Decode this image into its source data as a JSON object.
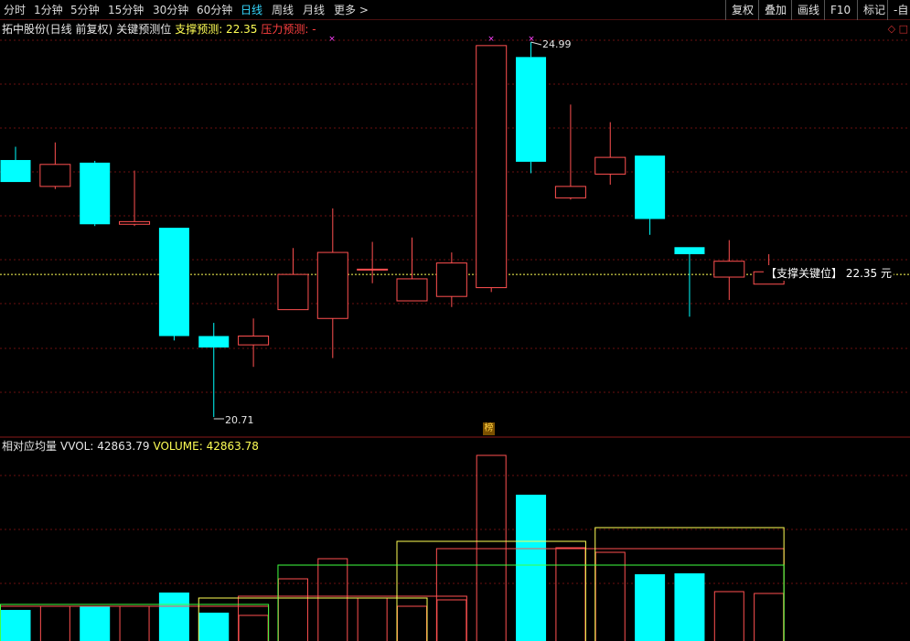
{
  "toolbar": {
    "periods": [
      {
        "label": "分时",
        "active": false
      },
      {
        "label": "1分钟",
        "active": false
      },
      {
        "label": "5分钟",
        "active": false
      },
      {
        "label": "15分钟",
        "active": false
      },
      {
        "label": "30分钟",
        "active": false
      },
      {
        "label": "60分钟",
        "active": false
      },
      {
        "label": "日线",
        "active": true
      },
      {
        "label": "周线",
        "active": false
      },
      {
        "label": "月线",
        "active": false
      },
      {
        "label": "更多 >",
        "active": false
      }
    ],
    "right_buttons": [
      "复权",
      "叠加",
      "画线",
      "F10",
      "标记",
      "-自"
    ]
  },
  "price_panel": {
    "stock_name": "拓中股份(日线 前复权)",
    "indicator_name": "关键预测位",
    "support_label": "支撑预测: 22.35",
    "pressure_label": "压力预测: -",
    "support_line_label": "【支撑关键位】 22.35 元",
    "high_annotation": "24.99",
    "low_annotation": "20.71",
    "corner_icons": "◇ □",
    "badge": "榜"
  },
  "volume_panel": {
    "title": "相对应均量",
    "vvol_label": "VVOL: 42863.79",
    "volume_label": "VOLUME: 42863.78"
  },
  "colors": {
    "up": "#ff5050",
    "down": "#00ffff",
    "grid": "#6a1010",
    "support": "#ffff55"
  },
  "chart_data": {
    "type": "candlestick",
    "support_price": 22.35,
    "price_high": 24.99,
    "price_low": 20.71,
    "candles": [
      {
        "o": 23.65,
        "h": 23.8,
        "l": 23.45,
        "c": 23.4
      },
      {
        "o": 23.35,
        "h": 23.85,
        "l": 23.32,
        "c": 23.6
      },
      {
        "o": 23.62,
        "h": 23.64,
        "l": 22.9,
        "c": 22.92
      },
      {
        "o": 22.92,
        "h": 23.53,
        "l": 22.9,
        "c": 22.95
      },
      {
        "o": 22.88,
        "h": 22.88,
        "l": 21.6,
        "c": 21.65
      },
      {
        "o": 21.65,
        "h": 21.8,
        "l": 20.73,
        "c": 21.52
      },
      {
        "o": 21.55,
        "h": 21.85,
        "l": 21.3,
        "c": 21.65
      },
      {
        "o": 21.95,
        "h": 22.65,
        "l": 21.95,
        "c": 22.35
      },
      {
        "o": 21.85,
        "h": 23.1,
        "l": 21.4,
        "c": 22.6
      },
      {
        "o": 22.4,
        "h": 22.72,
        "l": 22.25,
        "c": 22.41
      },
      {
        "o": 22.05,
        "h": 22.77,
        "l": 22.05,
        "c": 22.3
      },
      {
        "o": 22.1,
        "h": 22.6,
        "l": 21.98,
        "c": 22.48
      },
      {
        "o": 22.2,
        "h": 24.95,
        "l": 22.15,
        "c": 24.95
      },
      {
        "o": 24.82,
        "h": 24.99,
        "l": 23.5,
        "c": 23.63
      },
      {
        "o": 23.22,
        "h": 24.28,
        "l": 23.2,
        "c": 23.35
      },
      {
        "o": 23.49,
        "h": 24.08,
        "l": 23.37,
        "c": 23.68
      },
      {
        "o": 23.7,
        "h": 23.7,
        "l": 22.8,
        "c": 22.98
      },
      {
        "o": 22.66,
        "h": 22.66,
        "l": 21.87,
        "c": 22.58
      },
      {
        "o": 22.32,
        "h": 22.74,
        "l": 22.06,
        "c": 22.5
      },
      {
        "o": 22.24,
        "h": 22.58,
        "l": 22.24,
        "c": 22.38
      }
    ],
    "volumes": [
      {
        "v": 34000,
        "dir": "down"
      },
      {
        "v": 38000,
        "dir": "up"
      },
      {
        "v": 38000,
        "dir": "down"
      },
      {
        "v": 38000,
        "dir": "up"
      },
      {
        "v": 53000,
        "dir": "down"
      },
      {
        "v": 31000,
        "dir": "down"
      },
      {
        "v": 28000,
        "dir": "up"
      },
      {
        "v": 68000,
        "dir": "up"
      },
      {
        "v": 90000,
        "dir": "up"
      },
      {
        "v": 47000,
        "dir": "up"
      },
      {
        "v": 38000,
        "dir": "up"
      },
      {
        "v": 45000,
        "dir": "up"
      },
      {
        "v": 203000,
        "dir": "up"
      },
      {
        "v": 160000,
        "dir": "down"
      },
      {
        "v": 102000,
        "dir": "up"
      },
      {
        "v": 97000,
        "dir": "up"
      },
      {
        "v": 73000,
        "dir": "down"
      },
      {
        "v": 74000,
        "dir": "down"
      },
      {
        "v": 54000,
        "dir": "up"
      },
      {
        "v": 52000,
        "dir": "up"
      }
    ],
    "volume_avg_lines": [
      {
        "color": "#ff5050",
        "segments": [
          {
            "from": 0,
            "to": 6,
            "v": 38000
          },
          {
            "from": 6,
            "to": 11,
            "v": 49000
          },
          {
            "from": 11,
            "to": 19,
            "v": 101000
          }
        ]
      },
      {
        "color": "#ffff55",
        "segments": [
          {
            "from": 5,
            "to": 10,
            "v": 47000
          },
          {
            "from": 10,
            "to": 14,
            "v": 109000
          },
          {
            "from": 15,
            "to": 19,
            "v": 124000
          }
        ]
      },
      {
        "color": "#40ff40",
        "segments": [
          {
            "from": 0,
            "to": 6,
            "v": 40000
          },
          {
            "from": 7,
            "to": 19,
            "v": 83000
          }
        ]
      }
    ]
  }
}
